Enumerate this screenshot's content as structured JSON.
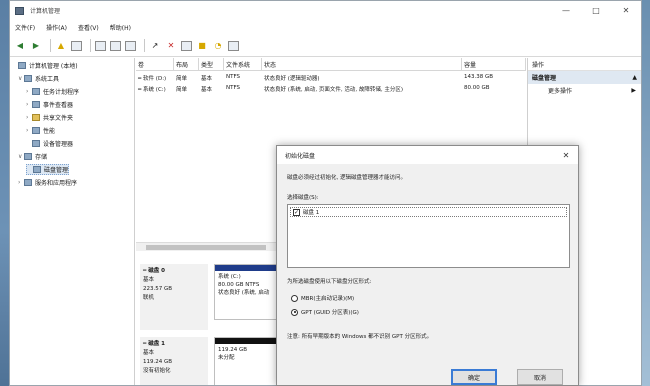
{
  "window": {
    "title": "计算机管理"
  },
  "controls": {
    "minimize": "—",
    "maximize": "□",
    "close": "✕"
  },
  "menu": [
    "文件(F)",
    "操作(A)",
    "查看(V)",
    "帮助(H)"
  ],
  "tree": [
    {
      "label": "计算机管理 (本地)",
      "level": 0,
      "exp": "",
      "icon": "computer-icon"
    },
    {
      "label": "系统工具",
      "level": 1,
      "exp": "∨",
      "icon": "tools-icon"
    },
    {
      "label": "任务计划程序",
      "level": 2,
      "exp": "›",
      "icon": "task-scheduler-icon"
    },
    {
      "label": "事件查看器",
      "level": 2,
      "exp": "›",
      "icon": "event-viewer-icon"
    },
    {
      "label": "共享文件夹",
      "level": 2,
      "exp": "›",
      "icon": "shared-folder-icon"
    },
    {
      "label": "性能",
      "level": 2,
      "exp": "›",
      "icon": "performance-icon"
    },
    {
      "label": "设备管理器",
      "level": 2,
      "exp": "",
      "icon": "device-manager-icon"
    },
    {
      "label": "存储",
      "level": 1,
      "exp": "∨",
      "icon": "storage-icon"
    },
    {
      "label": "磁盘管理",
      "level": 2,
      "exp": "",
      "icon": "disk-management-icon",
      "selected": true
    },
    {
      "label": "服务和应用程序",
      "level": 1,
      "exp": "›",
      "icon": "services-icon"
    }
  ],
  "columns": [
    "卷",
    "布局",
    "类型",
    "文件系统",
    "状态",
    "容量"
  ],
  "volumes": [
    {
      "vol": "━ 软件 (D:)",
      "layout": "简单",
      "type": "基本",
      "fs": "NTFS",
      "status": "状态良好 (逻辑驱动器)",
      "size": "143.38 GB"
    },
    {
      "vol": "━ 系统 (C:)",
      "layout": "简单",
      "type": "基本",
      "fs": "NTFS",
      "status": "状态良好 (系统, 启动, 页面文件, 活动, 故障转储, 主分区)",
      "size": "80.00 GB"
    }
  ],
  "disks": [
    {
      "title": "━ 磁盘 0",
      "kind": "基本",
      "size": "223.57 GB",
      "state": "联机"
    },
    {
      "title": "━ 磁盘 1",
      "kind": "基本",
      "size": "119.24 GB",
      "state": "没有初始化"
    }
  ],
  "partitions": [
    {
      "name": "系统 (C:)",
      "detail": "80.00 GB NTFS",
      "status": "状态良好 (系统, 启动",
      "bar": "#1f3c8a"
    },
    {
      "name": "",
      "detail": "119.24 GB",
      "status": "未分配",
      "bar": "#111111"
    }
  ],
  "actions": {
    "header": "操作",
    "section": "磁盘管理",
    "section_arrow": "▲",
    "more": "更多操作",
    "more_arrow": "▶"
  },
  "dialog": {
    "title": "初始化磁盘",
    "close": "✕",
    "intro": "磁盘必须经过初始化, 逻辑磁盘管理器才能访问。",
    "select_label": "选择磁盘(S):",
    "disk_item": "磁盘 1",
    "disk_checked": true,
    "style_label": "为所选磁盘使用以下磁盘分区形式:",
    "option_mbr": "MBR(主启动记录)(M)",
    "option_gpt": "GPT (GUID 分区表)(G)",
    "gpt_selected": true,
    "note": "注意: 所有早期版本的 Windows 都不识别 GPT 分区形式。",
    "ok": "确定",
    "cancel": "取消"
  }
}
